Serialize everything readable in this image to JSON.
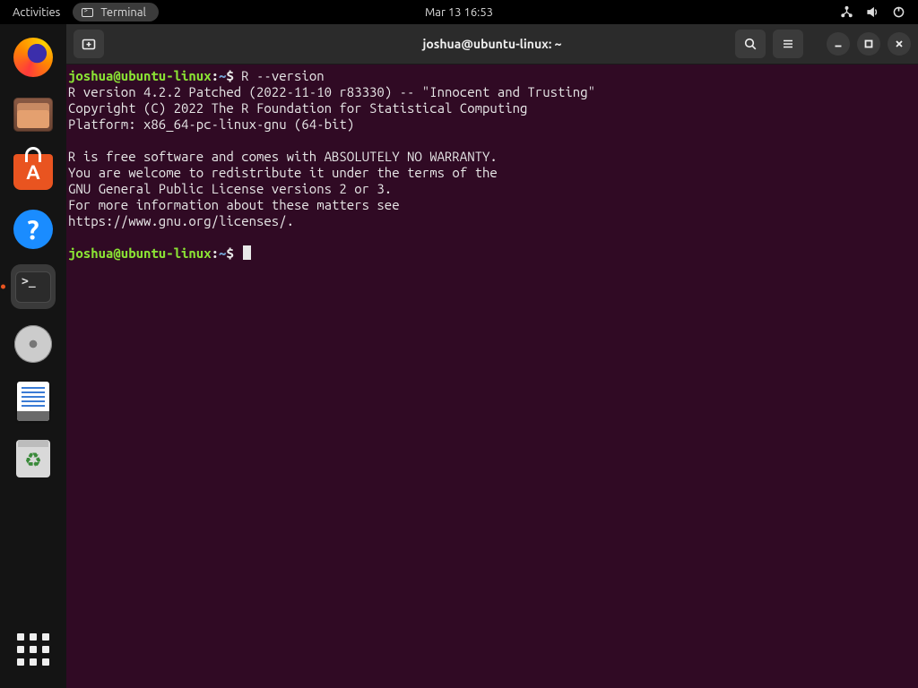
{
  "topbar": {
    "activities": "Activities",
    "app_label": "Terminal",
    "clock": "Mar 13  16:53"
  },
  "window": {
    "title": "joshua@ubuntu-linux: ~"
  },
  "prompt": {
    "userhost": "joshua@ubuntu-linux",
    "sep": ":",
    "path": "~",
    "dollar": "$"
  },
  "terminal": {
    "command": " R --version",
    "lines": [
      "R version 4.2.2 Patched (2022-11-10 r83330) -- \"Innocent and Trusting\"",
      "Copyright (C) 2022 The R Foundation for Statistical Computing",
      "Platform: x86_64-pc-linux-gnu (64-bit)",
      "",
      "R is free software and comes with ABSOLUTELY NO WARRANTY.",
      "You are welcome to redistribute it under the terms of the",
      "GNU General Public License versions 2 or 3.",
      "For more information about these matters see",
      "https://www.gnu.org/licenses/.",
      ""
    ]
  },
  "dock": {
    "items": [
      "firefox",
      "files",
      "software",
      "help",
      "terminal",
      "disc",
      "text-editor",
      "trash"
    ]
  }
}
